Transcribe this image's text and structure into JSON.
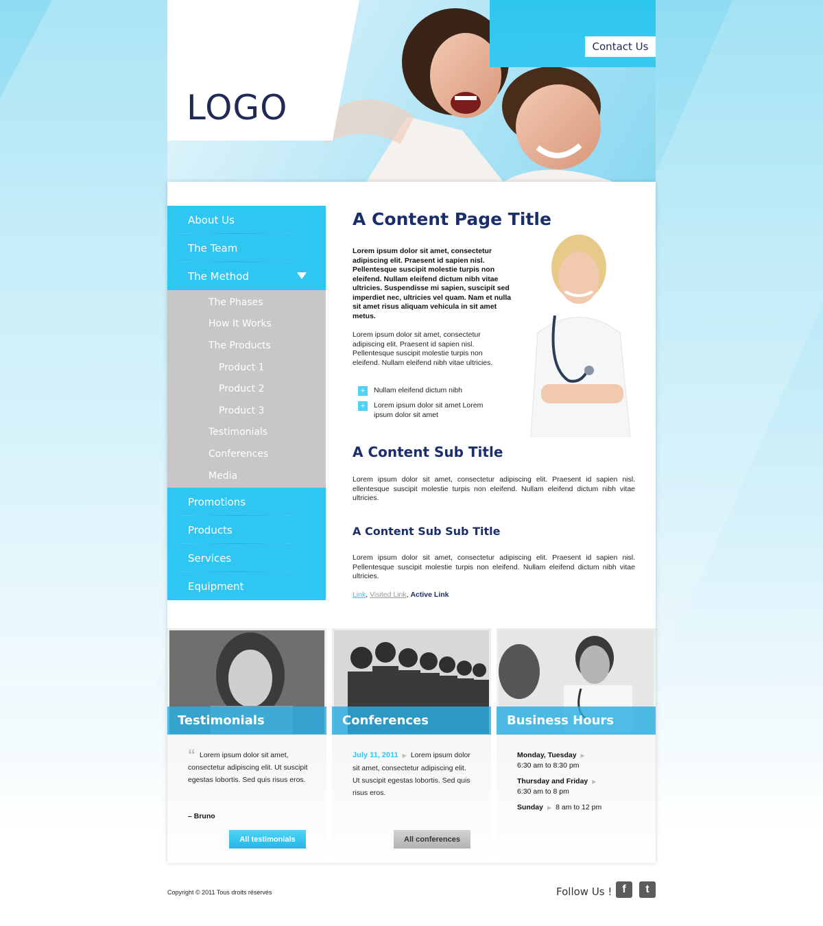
{
  "header": {
    "logo": "LOGO",
    "contact": "Contact Us"
  },
  "nav": {
    "items_top": [
      "About Us",
      "The Team",
      "The Method"
    ],
    "sub_items": [
      {
        "label": "The Phases",
        "level": 1
      },
      {
        "label": "How It Works",
        "level": 1
      },
      {
        "label": "The Products",
        "level": 1
      },
      {
        "label": "Product 1",
        "level": 2
      },
      {
        "label": "Product 2",
        "level": 2
      },
      {
        "label": "Product 3",
        "level": 2
      },
      {
        "label": "Testimonials",
        "level": 1
      },
      {
        "label": "Conferences",
        "level": 1
      },
      {
        "label": "Media",
        "level": 1
      }
    ],
    "items_bottom": [
      "Promotions",
      "Products",
      "Services",
      "Equipment"
    ]
  },
  "content": {
    "title": "A Content Page Title",
    "intro_bold": "Lorem ipsum dolor sit amet, consectetur adipiscing elit. Praesent id sapien nisl. Pellentesque suscipit molestie turpis non eleifend. Nullam eleifend dictum nibh vitae ultricies. Suspendisse mi sapien, suscipit sed imperdiet nec, ultricies vel quam. Nam et nulla sit amet risus aliquam vehicula in sit amet metus.",
    "intro_p": "Lorem ipsum dolor sit amet, consectetur adipiscing elit. Praesent id sapien nisl. Pellentesque suscipit molestie turpis non eleifend. Nullam eleifend nibh vitae ultricies.",
    "bullets": [
      "Nullam eleifend dictum nibh",
      "Lorem ipsum dolor sit amet Lorem ipsum dolor sit amet"
    ],
    "bullet_symbol": "+",
    "sub_title": "A Content Sub Title",
    "sub_p1": "Lorem ipsum dolor sit amet, consectetur adipiscing elit. Praesent id sapien nisl. ellentesque suscipit molestie turpis non eleifend. Nullam eleifend dictum nibh vitae ultricies.",
    "subsub_title": "A Content Sub Sub Title",
    "sub_p2": "Lorem ipsum dolor sit amet, consectetur adipiscing elit. Praesent id sapien nisl. Pellentesque suscipit molestie turpis non eleifend. Nullam eleifend dictum nibh vitae ultricies.",
    "links": {
      "link": "Link",
      "visited": "Visited Link",
      "active": "Active Link",
      "sep": ","
    }
  },
  "boxes": {
    "testimonials": {
      "caption": "Testimonials",
      "quote_mark": "“",
      "text": "Lorem ipsum dolor sit amet, consectetur adipiscing elit. Ut suscipit egestas lobortis. Sed quis risus eros.",
      "author": "– Bruno",
      "button": "All testimonials"
    },
    "conferences": {
      "caption": "Conferences",
      "date": "July 11, 2011",
      "text": "Lorem ipsum dolor sit amet, consectetur adipiscing elit. Ut suscipit egestas lobortis. Sed quis risus eros.",
      "button": "All conferences"
    },
    "hours": {
      "caption": "Business Hours",
      "rows": [
        {
          "days": "Monday, Tuesday",
          "time": "6:30 am to 8:30 pm"
        },
        {
          "days": "Thursday and Friday",
          "time": "6:30 am to 8 pm"
        },
        {
          "days": "Sunday",
          "time": "8 am to 12 pm"
        }
      ]
    }
  },
  "footer": {
    "copyright": "Copyright © 2011 Tous droits réservés",
    "follow": "Follow Us !",
    "facebook_letter": "f",
    "twitter_letter": "t"
  },
  "colors": {
    "accent": "#2fc6f2",
    "title": "#1b2e6b",
    "subnav": "#c7c7c7"
  }
}
